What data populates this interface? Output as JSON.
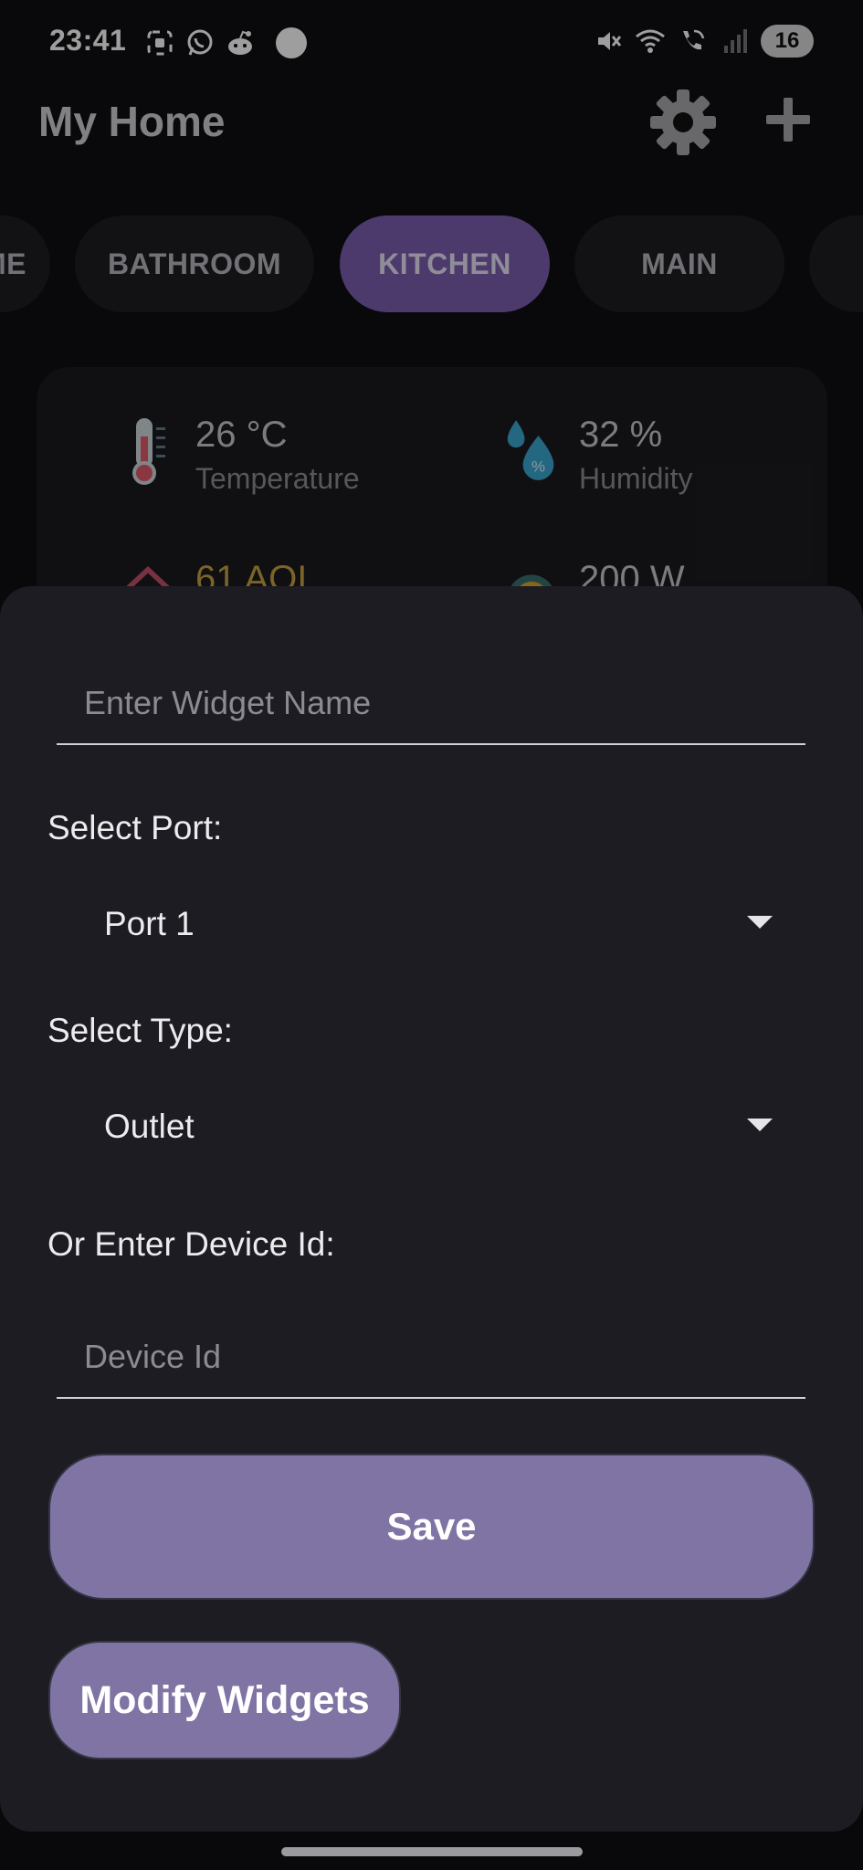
{
  "status_bar": {
    "time": "23:41",
    "battery": "16",
    "left_icons": [
      "screenshot-icon",
      "whatsapp-icon",
      "reddit-icon"
    ],
    "right_icons": [
      "mute-icon",
      "wifi-icon",
      "wifi-call-icon",
      "signal-icon"
    ]
  },
  "header": {
    "title": "My Home",
    "settings_icon": "gear-icon",
    "add_icon": "plus-icon"
  },
  "tabs": [
    {
      "label": "ME",
      "active": false
    },
    {
      "label": "BATHROOM",
      "active": false
    },
    {
      "label": "KITCHEN",
      "active": true
    },
    {
      "label": "MAIN",
      "active": false
    },
    {
      "label": "",
      "active": false
    }
  ],
  "sensors": [
    {
      "value": "26 °C",
      "label": "Temperature",
      "icon": "thermometer-icon"
    },
    {
      "value": "32 %",
      "label": "Humidity",
      "icon": "humidity-icon"
    },
    {
      "value": "61 AQI",
      "label": "",
      "icon": "air-quality-icon"
    },
    {
      "value": "200 W",
      "label": "",
      "icon": "power-icon"
    }
  ],
  "colors": {
    "accent_tab": "#7b5eb0",
    "button": "#7f74a3",
    "sheet_bg": "#1c1c22",
    "aqi_text": "#c8a040"
  },
  "form": {
    "widget_name": {
      "value": "",
      "placeholder": "Enter Widget Name"
    },
    "port_label": "Select Port:",
    "port_value": "Port 1",
    "type_label": "Select Type:",
    "type_value": "Outlet",
    "device_label": "Or Enter Device Id:",
    "device_id": {
      "value": "",
      "placeholder": "Device Id"
    },
    "save_label": "Save",
    "modify_label": "Modify Widgets"
  }
}
